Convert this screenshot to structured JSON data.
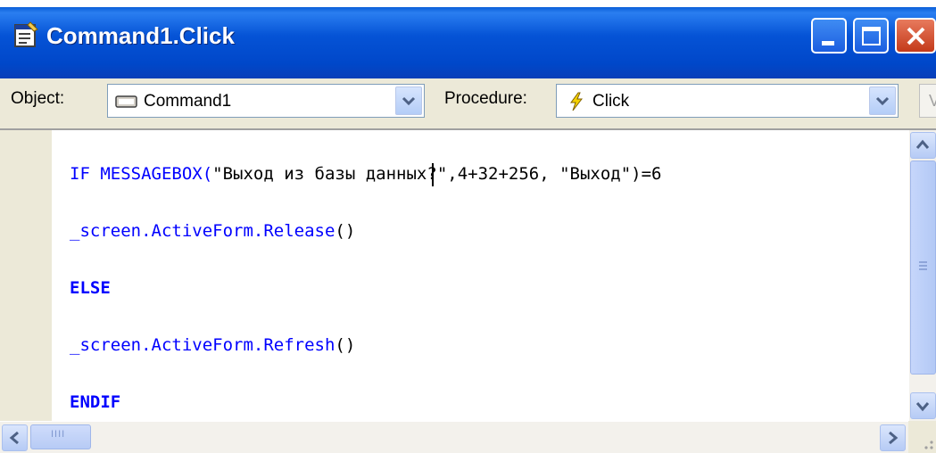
{
  "window": {
    "title": "Command1.Click"
  },
  "toolbar": {
    "object_label": "Object:",
    "object_value": "Command1",
    "procedure_label": "Procedure:",
    "procedure_value": "Click",
    "extra_button_label": "V"
  },
  "code_lines": [
    {
      "a": "IF MESSAGEBOX(",
      "b": "\"Выход из базы данных?\",4+32+256, \"Выход\")=6"
    },
    {
      "a": "_screen.ActiveForm.Release",
      "b": "()"
    },
    {
      "a": "ELSE",
      "b": ""
    },
    {
      "a": "_screen.ActiveForm.Refresh",
      "b": "()"
    },
    {
      "a": "ENDIF",
      "b": ""
    }
  ],
  "scrollbar": {
    "horizontal_grip": "IIII"
  },
  "colors": {
    "titlebar": "#0553d6",
    "keyword": "#0000ff",
    "string": "#000000",
    "background": "#ece9d8"
  },
  "icons": [
    "form-icon",
    "minimize-icon",
    "maximize-icon",
    "close-icon",
    "command-button-icon",
    "lightning-icon",
    "chevron-down-icon",
    "arrow-up-icon",
    "arrow-down-icon",
    "arrow-left-icon",
    "arrow-right-icon"
  ]
}
